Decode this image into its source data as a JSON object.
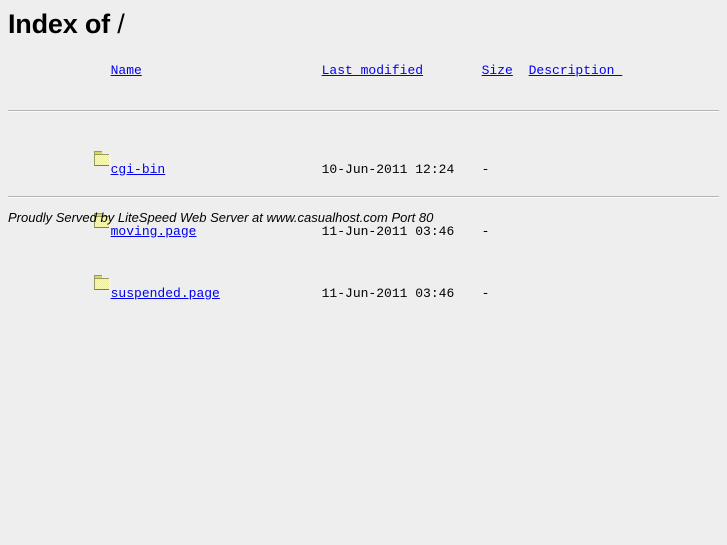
{
  "page": {
    "title_label": "Index of ",
    "path": "/",
    "background_color": "#eeeeee",
    "link_color": "#0000ee"
  },
  "table": {
    "columns": [
      {
        "key": "name",
        "label": "Name",
        "is_link": true
      },
      {
        "key": "last_modified",
        "label": "Last modified",
        "is_link": true
      },
      {
        "key": "size",
        "label": "Size",
        "is_link": true
      },
      {
        "key": "description",
        "label": "Description ",
        "is_link": true
      }
    ],
    "rows": [
      {
        "icon": "folder-icon",
        "name": "cgi-bin",
        "last_modified": "10-Jun-2011 12:24",
        "size": "-",
        "description": ""
      },
      {
        "icon": "folder-icon",
        "name": "moving.page",
        "last_modified": "11-Jun-2011 03:46",
        "size": "-",
        "description": ""
      },
      {
        "icon": "folder-icon",
        "name": "suspended.page",
        "last_modified": "11-Jun-2011 03:46",
        "size": "-",
        "description": ""
      }
    ]
  },
  "footer": {
    "text": "Proudly Served by LiteSpeed Web Server at www.casualhost.com Port 80"
  }
}
